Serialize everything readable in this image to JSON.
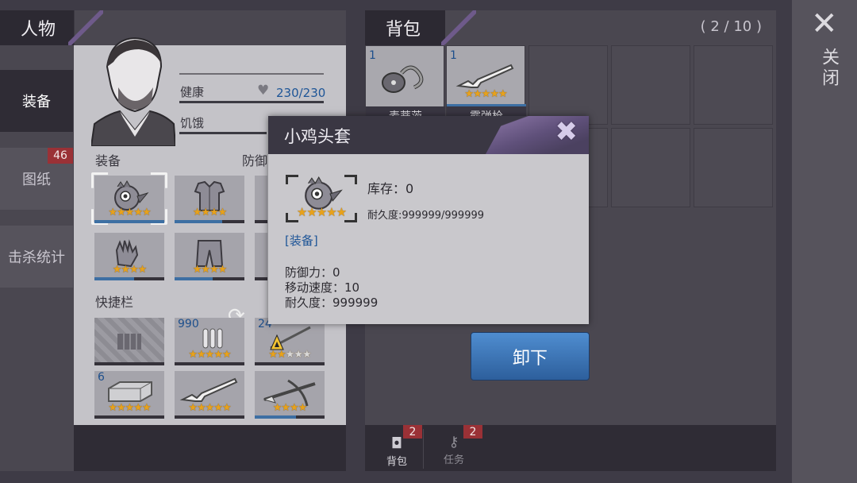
{
  "character_panel": {
    "title": "人物"
  },
  "bag_panel": {
    "title": "背包",
    "capacity": "( 2 / 10 )"
  },
  "left_nav": {
    "items": [
      {
        "label": "装备",
        "active": true
      },
      {
        "label": "图纸",
        "badge": "46"
      },
      {
        "label": "击杀统计"
      }
    ]
  },
  "stats": {
    "health_label": "健康",
    "health_value": "230/230",
    "hunger_label": "饥饿"
  },
  "equip_section": {
    "label": "装备",
    "defense_label": "防御"
  },
  "quickbar_section": {
    "label": "快捷栏"
  },
  "equip_slots": [
    {
      "icon": "chicken-head-helmet-icon",
      "stars": 5
    },
    {
      "icon": "body-armor-icon",
      "stars": 4
    },
    {
      "icon": "gloves-icon",
      "stars": 4
    },
    {
      "icon": "pants-icon",
      "stars": 3
    }
  ],
  "quick_slots": [
    {
      "icon": "empty-slot-icon"
    },
    {
      "icon": "bullets-icon",
      "qty": "990",
      "stars": 5
    },
    {
      "icon": "fire-spear-icon",
      "qty": "24",
      "stars": 2
    },
    {
      "icon": "brick-icon",
      "qty": "6",
      "stars": 5
    },
    {
      "icon": "shotgun-icon",
      "stars": 5
    },
    {
      "icon": "crossbow-icon",
      "stars": 4
    }
  ],
  "bag_items": [
    {
      "qty": "1",
      "icon": "rope-coil-icon",
      "name": "麦蒂茨"
    },
    {
      "qty": "1",
      "icon": "shotgun-icon",
      "name": "霰弹枪",
      "stars": 5
    }
  ],
  "close": {
    "label": "关闭"
  },
  "modal": {
    "title": "小鸡头套",
    "stock": "库存：0",
    "durability_line": "耐久度:999999/999999",
    "tag": "[装备]",
    "defense": "防御力：0",
    "speed": "移动速度：10",
    "durability": "耐久度：999999",
    "item_stars": 5
  },
  "unequip_button": {
    "label": "卸下"
  },
  "bottom_tabs": [
    {
      "label": "背包",
      "badge": "2"
    },
    {
      "label": "任务",
      "badge": "2"
    }
  ],
  "colors": {
    "accent_blue": "#3d6fa3",
    "star": "#e8a21b",
    "badge_red": "#9a3136",
    "purple": "#6e5a8a"
  }
}
